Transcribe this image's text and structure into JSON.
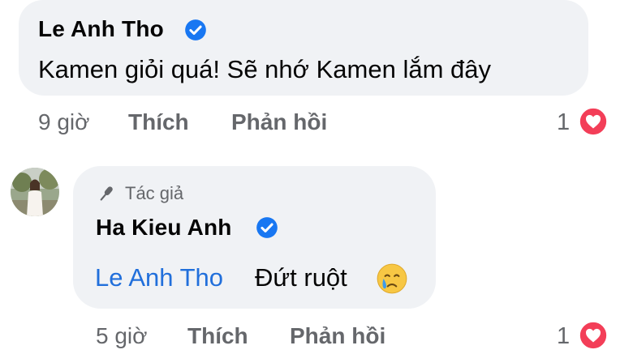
{
  "comment1": {
    "author": "Le Anh Tho",
    "text": "Kamen giỏi quá! Sẽ nhớ Kamen lắm đây",
    "time": "9 giờ",
    "like_label": "Thích",
    "reply_label": "Phản hồi",
    "reaction_count": "1"
  },
  "reply": {
    "author_badge": "Tác giả",
    "author": "Ha Kieu Anh",
    "mention": "Le Anh Tho",
    "text": "Đứt ruột",
    "emoji": "crying-face",
    "time": "5 giờ",
    "like_label": "Thích",
    "reply_label": "Phản hồi",
    "reaction_count": "1"
  },
  "colors": {
    "bubble": "#f0f2f5",
    "verified": "#1877f2",
    "mention": "#216fdb",
    "meta": "#65676b",
    "heart": "#f33e58"
  }
}
